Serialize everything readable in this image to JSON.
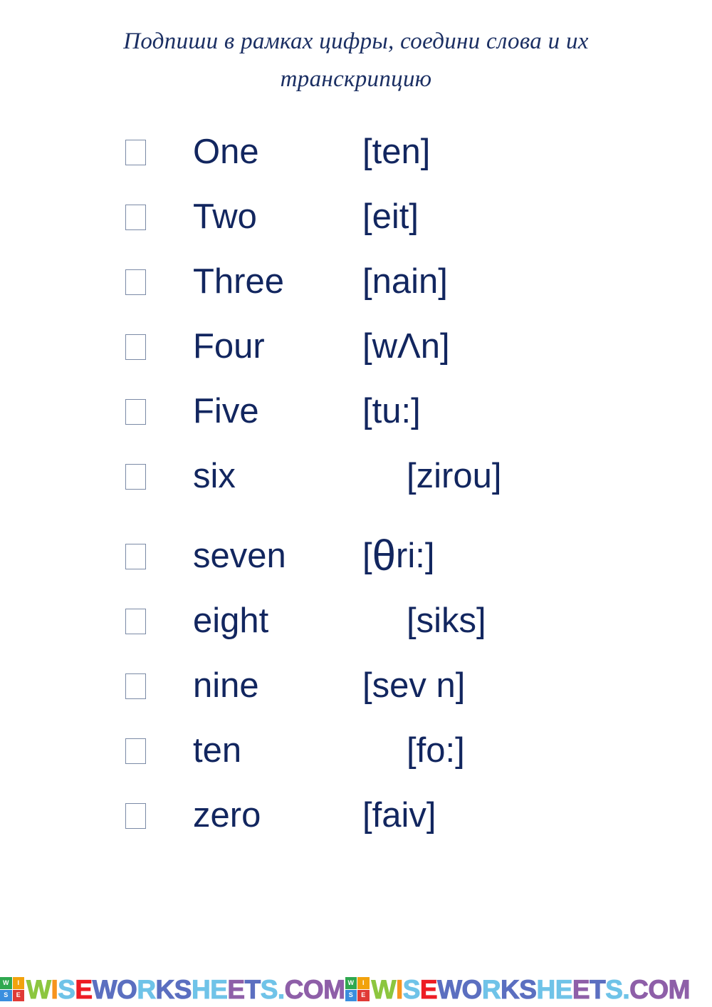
{
  "document": {
    "title_lines": [
      "Подпиши в рамках цифры, соедини слова и их",
      "транскрипцию"
    ],
    "text_color": "#12265f",
    "title_color": "#1b2f63",
    "checkbox_border_color": "#7b8aa6",
    "background": "#ffffff"
  },
  "exercise": {
    "rows": [
      {
        "word": "One",
        "transcription": "[ten]",
        "indent": 0
      },
      {
        "word": "Two",
        "transcription": "[eit]",
        "indent": 0
      },
      {
        "word": "Three",
        "transcription": "[nain]",
        "indent": 0
      },
      {
        "word": "Four",
        "transcription": "[wΛn]",
        "indent": 0
      },
      {
        "word": "Five",
        "transcription": "[tu:]",
        "indent": 0
      },
      {
        "word": "six",
        "transcription": "[zirou]",
        "indent": 62
      },
      {
        "word": "seven",
        "transcription": "[θri:]",
        "indent": 0
      },
      {
        "word": "eight",
        "transcription": "[siks]",
        "indent": 62
      },
      {
        "word": "nine",
        "transcription": "[sev n]",
        "indent": 0
      },
      {
        "word": "ten",
        "transcription": "[fo:]",
        "indent": 62
      },
      {
        "word": "zero",
        "transcription": "[faiv]",
        "indent": 0
      }
    ]
  },
  "footer": {
    "watermark_text": "WISEWORKSHEETS.COM",
    "badge_letters": [
      "W",
      "I",
      "S",
      "E"
    ],
    "letter_colors": [
      "#8cc63f",
      "#f7941e",
      "#6fc3e8",
      "#ed1c24",
      "#5b6fc0",
      "#5b6fc0",
      "#6fc3e8",
      "#5b6fc0",
      "#5b6fc0",
      "#6fc3e8",
      "#6fc3e8",
      "#8e5fa8",
      "#5b6fc0",
      "#6fc3e8",
      "#6fc3e8",
      "#8e5fa8",
      "#8e5fa8",
      "#8e5fa8",
      "#8e5fa8",
      "#8e5fa8",
      "#8e5fa8",
      "#8e5fa8"
    ],
    "repeat_count": 2
  }
}
